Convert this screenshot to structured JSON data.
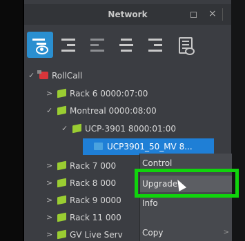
{
  "panel": {
    "title": "Network",
    "close_glyph": "×"
  },
  "toolbar": {
    "tools": [
      {
        "icon": "hierarchy-view-icon",
        "active": true
      },
      {
        "icon": "indent-list-icon",
        "active": false
      },
      {
        "icon": "outdent-list-icon",
        "active": false
      },
      {
        "icon": "center-list-icon",
        "active": false
      },
      {
        "icon": "right-list-icon",
        "active": false
      },
      {
        "icon": "document-view-icon",
        "active": false
      }
    ]
  },
  "tree": {
    "items": [
      {
        "label": "RollCall",
        "chevron": "✓",
        "icon": "rollcall-icon"
      },
      {
        "label": "Rack 6 0000:07:00",
        "chevron": ">",
        "icon": "rack-icon"
      },
      {
        "label": "Montreal 0000:08:00",
        "chevron": "✓",
        "icon": "rack-icon"
      },
      {
        "label": "UCP-3901 8000:01:00",
        "chevron": "✓",
        "icon": "rack-icon"
      },
      {
        "label": "UCP3901_50_MV 8...",
        "chevron": "",
        "icon": "card-icon"
      },
      {
        "label": "Rack 7 000",
        "chevron": ">",
        "icon": "rack-icon"
      },
      {
        "label": "Rack 8 000",
        "chevron": ">",
        "icon": "rack-icon"
      },
      {
        "label": "Rack 9 0000",
        "chevron": ">",
        "icon": "rack-icon"
      },
      {
        "label": "Rack 11 000",
        "chevron": ">",
        "icon": "rack-icon"
      },
      {
        "label": "GV Live Serv",
        "chevron": ">",
        "icon": "rack-icon"
      }
    ]
  },
  "context_menu": {
    "items": [
      {
        "label": "Control"
      },
      {
        "label": "Upgrade"
      },
      {
        "label": "Info"
      },
      {
        "label": "Copy",
        "has_submenu": true
      }
    ],
    "submenu_arrow": ">"
  },
  "colors": {
    "selection": "#1f7fd6",
    "highlight": "#10d40c",
    "active_tool": "#2a8fd0",
    "panel_bg": "#3b3d42"
  }
}
